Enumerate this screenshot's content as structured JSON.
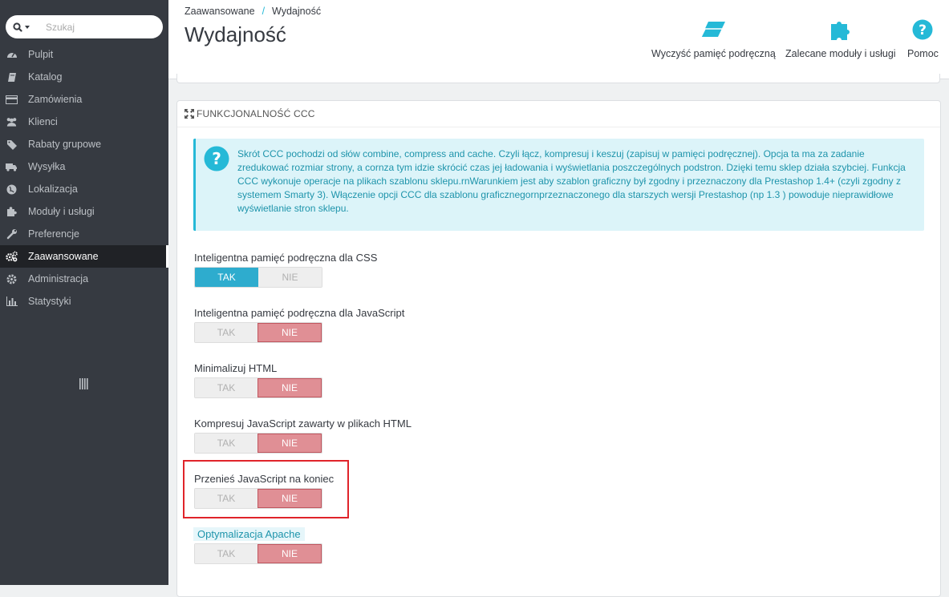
{
  "sidebar": {
    "search_placeholder": "Szukaj",
    "items": [
      {
        "label": "Pulpit",
        "icon": "dashboard-icon"
      },
      {
        "label": "Katalog",
        "icon": "book-icon"
      },
      {
        "label": "Zamówienia",
        "icon": "credit-card-icon"
      },
      {
        "label": "Klienci",
        "icon": "users-icon"
      },
      {
        "label": "Rabaty grupowe",
        "icon": "tags-icon"
      },
      {
        "label": "Wysyłka",
        "icon": "truck-icon"
      },
      {
        "label": "Lokalizacja",
        "icon": "globe-icon"
      },
      {
        "label": "Moduły i usługi",
        "icon": "puzzle-icon"
      },
      {
        "label": "Preferencje",
        "icon": "wrench-icon"
      },
      {
        "label": "Zaawansowane",
        "icon": "cogs-icon",
        "active": true
      },
      {
        "label": "Administracja",
        "icon": "cog-icon"
      },
      {
        "label": "Statystyki",
        "icon": "bar-chart-icon"
      }
    ]
  },
  "header": {
    "breadcrumb": [
      "Zaawansowane",
      "Wydajność"
    ],
    "title": "Wydajność",
    "toolbar": {
      "clear_cache": "Wyczyść pamięć podręczną",
      "modules": "Zalecane moduły i usługi",
      "help": "Pomoc"
    }
  },
  "panel": {
    "title": "FUNKCJONALNOŚĆ CCC",
    "info": "Skrót CCC pochodzi od słów combine, compress and cache. Czyli łącz, kompresuj i keszuj (zapisuj w pamięci podręcznej). Opcja ta ma za zadanie zredukować rozmiar strony, a cornza tym idzie skrócić czas jej ładowania i wyświetlania poszczególnych podstron. Dzięki temu sklep działa szybciej. Funkcja CCC wykonuje operacje na plikach szablonu sklepu.rnWarunkiem jest aby szablon graficzny był zgodny i przeznaczony dla Prestashop 1.4+ (czyli zgodny z systemem Smarty 3). Włączenie opcji CCC dla szablonu graficznegornprzeznaczonego dla starszych wersji Prestashop (np 1.3 ) powoduje nieprawidłowe wyświetlanie stron sklepu.",
    "yes_label": "TAK",
    "no_label": "NIE",
    "fields": [
      {
        "label": "Inteligentna pamięć podręczna dla CSS",
        "value": "TAK"
      },
      {
        "label": "Inteligentna pamięć podręczna dla JavaScript",
        "value": "NIE"
      },
      {
        "label": "Minimalizuj HTML",
        "value": "NIE"
      },
      {
        "label": "Kompresuj JavaScript zawarty w plikach HTML",
        "value": "NIE"
      },
      {
        "label": "Przenieś JavaScript na koniec",
        "value": "NIE"
      },
      {
        "label": "Optymalizacja Apache",
        "value": "NIE"
      }
    ]
  },
  "colors": {
    "sidebar_bg": "#363a41",
    "accent": "#25b9d7",
    "no_active": "#e08f95",
    "highlight_border": "#e0242a"
  }
}
